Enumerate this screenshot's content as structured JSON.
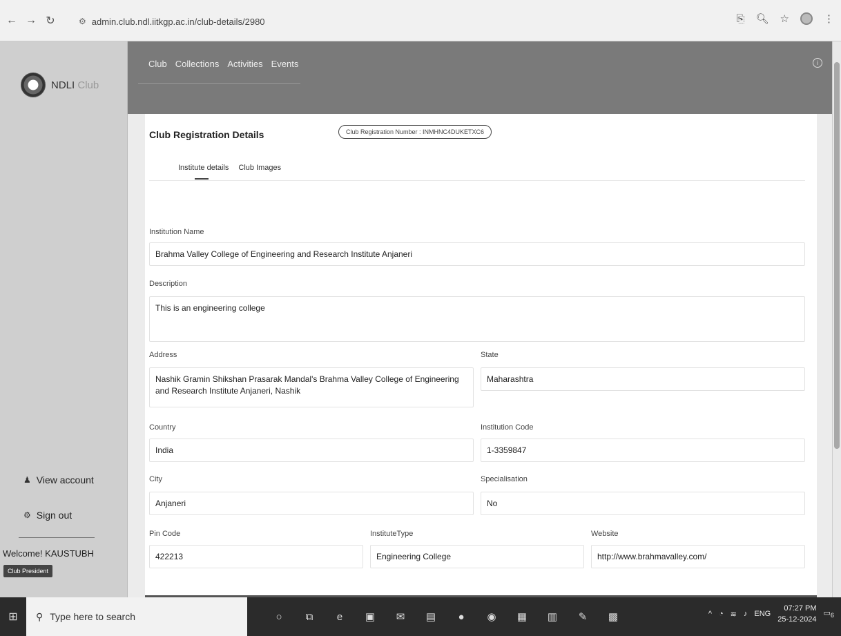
{
  "browser": {
    "url": "admin.club.ndl.iitkgp.ac.in/club-details/2980"
  },
  "sidebar": {
    "logo_text": "NDLI",
    "logo_sub": "Club",
    "view_account": "View account",
    "sign_out": "Sign out",
    "welcome": "Welcome! KAUSTUBH",
    "role": "Club President"
  },
  "topnav": {
    "menu": [
      "Club",
      "Collections",
      "Activities",
      "Events"
    ]
  },
  "card": {
    "title": "Club Registration Details",
    "reg_number": "Club Registration Number : INMHNC4DUKETXC6",
    "tabs": [
      "Institute details",
      "Club Images"
    ]
  },
  "fields": {
    "institution_name": {
      "label": "Institution Name",
      "value": "Brahma Valley College of Engineering and Research Institute Anjaneri"
    },
    "description": {
      "label": "Description",
      "value": "This is an engineering college"
    },
    "address": {
      "label": "Address",
      "value": "Nashik Gramin Shikshan Prasarak Mandal's Brahma Valley College of Engineering and Research Institute Anjaneri, Nashik"
    },
    "state": {
      "label": "State",
      "value": "Maharashtra"
    },
    "country": {
      "label": "Country",
      "value": "India"
    },
    "institution_code": {
      "label": "Institution Code",
      "value": "1-3359847"
    },
    "city": {
      "label": "City",
      "value": "Anjaneri"
    },
    "specialisation": {
      "label": "Specialisation",
      "value": "No"
    },
    "pin_code": {
      "label": "Pin Code",
      "value": "422213"
    },
    "institute_type": {
      "label": "InstituteType",
      "value": "Engineering College"
    },
    "website": {
      "label": "Website",
      "value": "http://www.brahmavalley.com/"
    }
  },
  "taskbar": {
    "search_placeholder": "Type here to search",
    "lang": "ENG",
    "time": "07:27 PM",
    "date": "25-12-2024",
    "notif_count": "6"
  }
}
